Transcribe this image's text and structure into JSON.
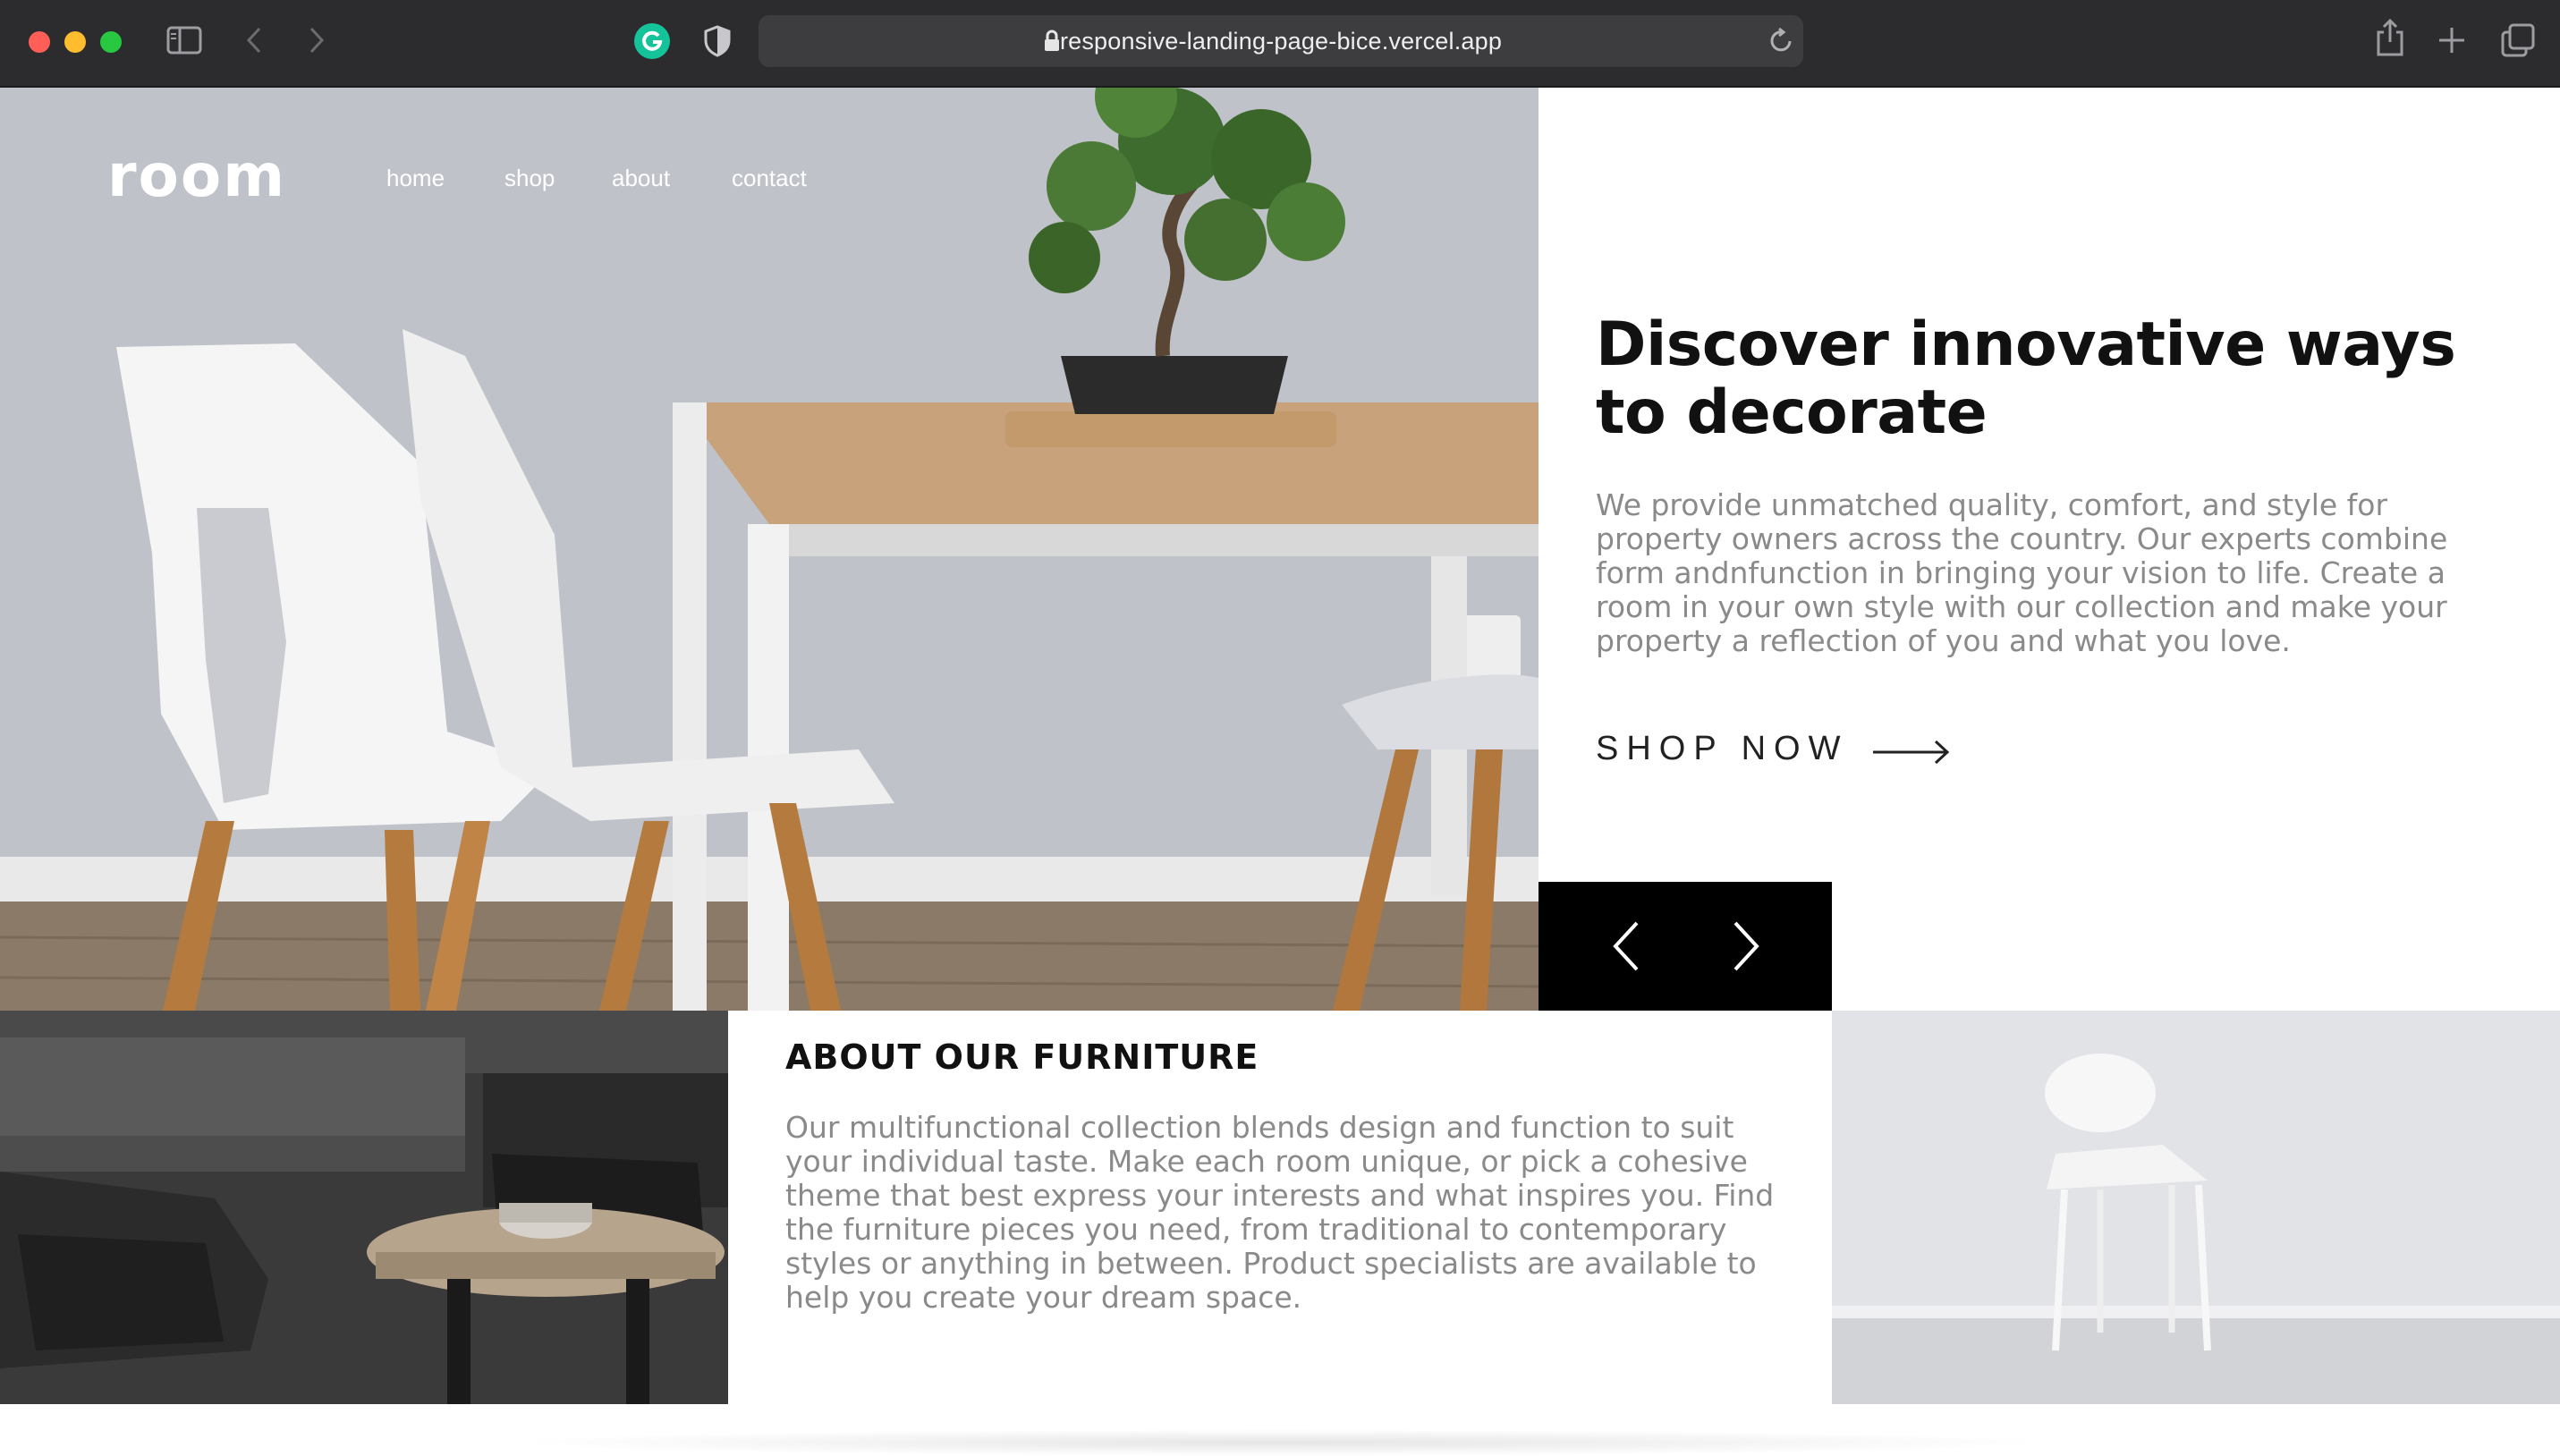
{
  "browser": {
    "url": "responsive-landing-page-bice.vercel.app",
    "icons": [
      "sidebar-icon",
      "back-icon",
      "forward-icon",
      "grammarly-icon",
      "shield-icon",
      "lock-icon",
      "reload-icon",
      "share-icon",
      "new-tab-icon",
      "tabs-overview-icon"
    ]
  },
  "header": {
    "logo": "room",
    "nav": [
      "home",
      "shop",
      "about",
      "contact"
    ]
  },
  "hero": {
    "title": "Discover innovative ways to decorate",
    "description": "We provide unmatched quality, comfort, and style for property owners across the country. Our experts combine form andnfunction in bringing your vision to life. Create a room in your own style with our collection and make your property a reflection of you and what you love.",
    "cta": "SHOP NOW",
    "cta_icon": "arrow-right-icon",
    "slider_icons": [
      "chevron-left-icon",
      "chevron-right-icon"
    ]
  },
  "about": {
    "title": "ABOUT OUR FURNITURE",
    "text": "Our multifunctional collection blends design and function to suit your individual taste. Make each room unique, or pick a cohesive theme that best express your interests and what inspires you. Find the furniture pieces you need, from traditional to contemporary styles or anything in between. Product specialists are available to help you create your dream space."
  },
  "colors": {
    "chrome": "#2c2c2e",
    "urlbar": "#3d3d40",
    "heading": "#111111",
    "body_text": "#8a8a8a",
    "slider_bg": "#000000"
  }
}
